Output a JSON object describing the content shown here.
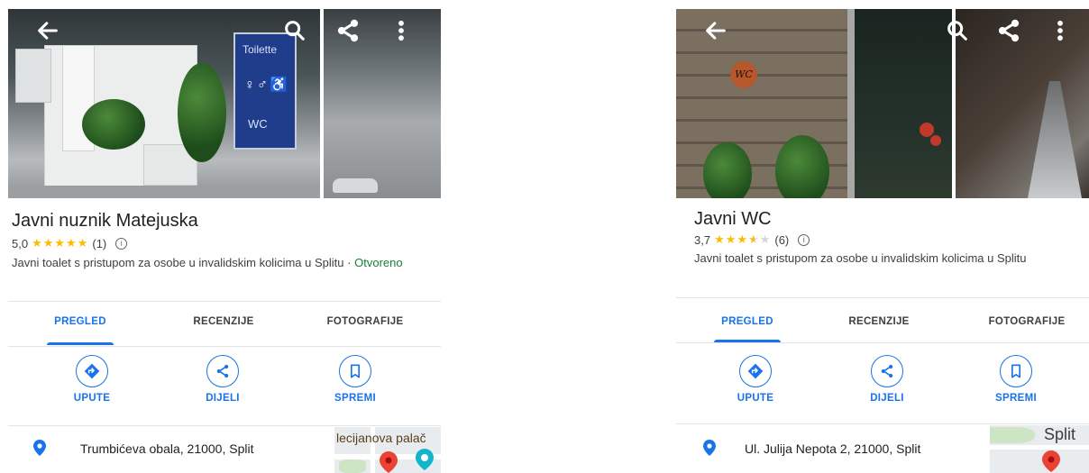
{
  "colors": {
    "accent_blue": "#1a73e8",
    "star_yellow": "#fbbc04",
    "open_green": "#188038",
    "pin_red": "#ea4335",
    "pin_teal": "#12b5cb"
  },
  "icons": {
    "back": "back-arrow-icon",
    "search": "search-icon",
    "share": "share-icon",
    "more": "more-vert-icon",
    "directions": "directions-icon",
    "save": "bookmark-icon",
    "location": "location-pin-icon",
    "info": "info-icon"
  },
  "left": {
    "photo_sign": {
      "toilette": "Toilette",
      "wc": "WC"
    },
    "title": "Javni nuznik Matejuska",
    "rating_value": "5,0",
    "rating": 5.0,
    "review_count": "(1)",
    "category_line": "Javni toalet s pristupom za osobe u invalidskim kolicima u Splitu",
    "separator": "·",
    "status": "Otvoreno",
    "tabs": [
      {
        "label": "PREGLED",
        "active": true
      },
      {
        "label": "RECENZIJE",
        "active": false
      },
      {
        "label": "FOTOGRAFIJE",
        "active": false
      }
    ],
    "actions": [
      {
        "label": "UPUTE"
      },
      {
        "label": "DIJELI"
      },
      {
        "label": "SPREMI"
      }
    ],
    "address": "Trumbićeva obala, 21000, Split",
    "map_label": "lecijanova palač"
  },
  "right": {
    "photo_sign": {
      "wc": "WC"
    },
    "title": "Javni WC",
    "rating_value": "3,7",
    "rating": 3.7,
    "review_count": "(6)",
    "category_line": "Javni toalet s pristupom za osobe u invalidskim kolicima u Splitu",
    "tabs": [
      {
        "label": "PREGLED",
        "active": true
      },
      {
        "label": "RECENZIJE",
        "active": false
      },
      {
        "label": "FOTOGRAFIJE",
        "active": false
      }
    ],
    "actions": [
      {
        "label": "UPUTE"
      },
      {
        "label": "DIJELI"
      },
      {
        "label": "SPREMI"
      }
    ],
    "address": "Ul. Julija Nepota 2, 21000, Split",
    "map_label": "Split"
  }
}
